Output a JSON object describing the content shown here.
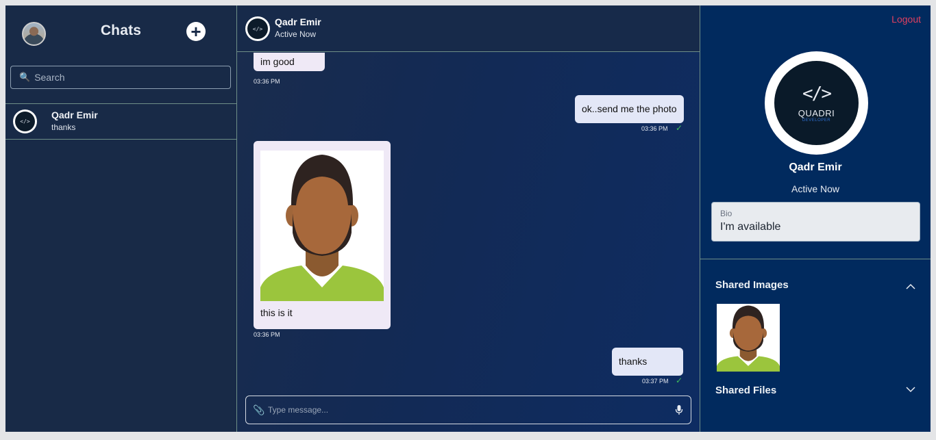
{
  "sidebar": {
    "title": "Chats",
    "search_placeholder": "Search",
    "chats": [
      {
        "name": "Qadr Emir",
        "preview": "thanks"
      }
    ]
  },
  "conversation": {
    "contact_name": "Qadr Emir",
    "contact_status": "Active Now",
    "messages": [
      {
        "direction": "in",
        "text": "im good",
        "time": "03:36 PM"
      },
      {
        "direction": "out",
        "text": "ok..send me the photo",
        "time": "03:36 PM"
      },
      {
        "direction": "in",
        "text": "this is it",
        "time": "03:36 PM",
        "has_image": true
      },
      {
        "direction": "out",
        "text": "thanks",
        "time": "03:37 PM"
      }
    ],
    "composer_placeholder": "Type message..."
  },
  "details": {
    "logout_label": "Logout",
    "logo_text": "QUADRI",
    "logo_sub": "DEVELOPER",
    "name": "Qadr Emir",
    "status": "Active Now",
    "bio_label": "Bio",
    "bio_value": "I'm available",
    "shared_images_label": "Shared Images",
    "shared_files_label": "Shared Files"
  },
  "colors": {
    "sidebar_bg": "#182a47",
    "details_bg": "#012a5e",
    "accent_logout": "#e04060",
    "read_check": "#3fbf5a"
  },
  "icons": [
    "search-icon",
    "plus-icon",
    "paperclip-icon",
    "microphone-icon",
    "chevron-up-icon",
    "chevron-down-icon",
    "check-icon"
  ]
}
